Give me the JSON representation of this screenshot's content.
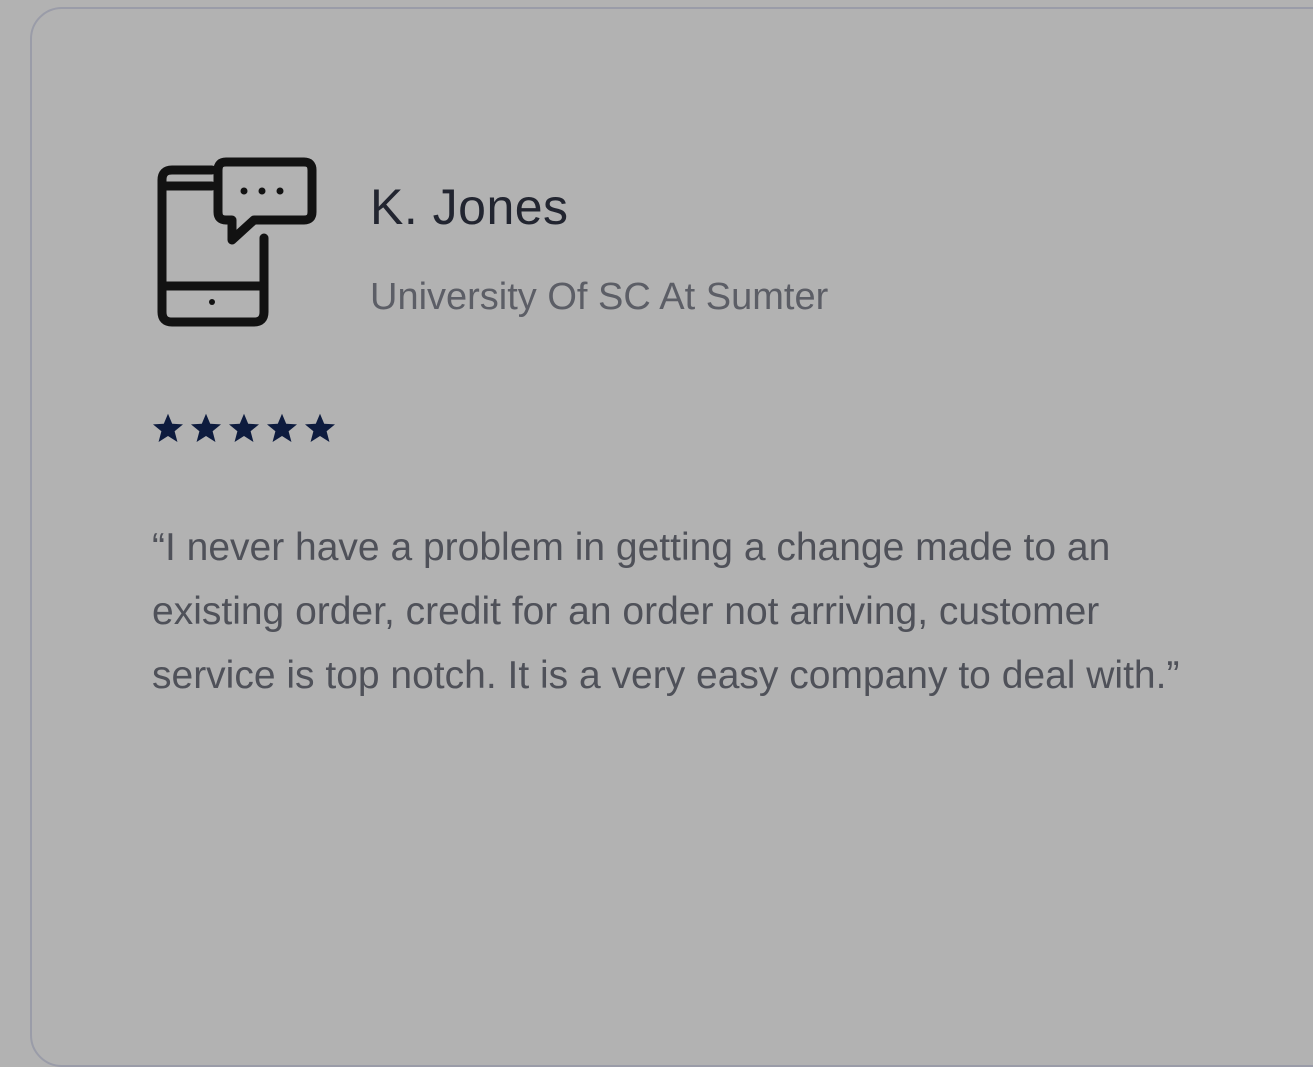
{
  "testimonial": {
    "icon": "mobile-chat-icon",
    "author_name": "K. Jones",
    "author_org": "University Of SC At Sumter",
    "rating": 5,
    "rating_max": 5,
    "quote": "“I never have a problem in getting a change made to an existing order, credit for an order not arriving, customer service is top notch. It is a very easy company to deal with.”"
  },
  "colors": {
    "background": "#b2b2b2",
    "card_border": "#9a9ca8",
    "name_text": "#222530",
    "secondary_text": "#5c5e66",
    "star": "#0d1b3e"
  }
}
